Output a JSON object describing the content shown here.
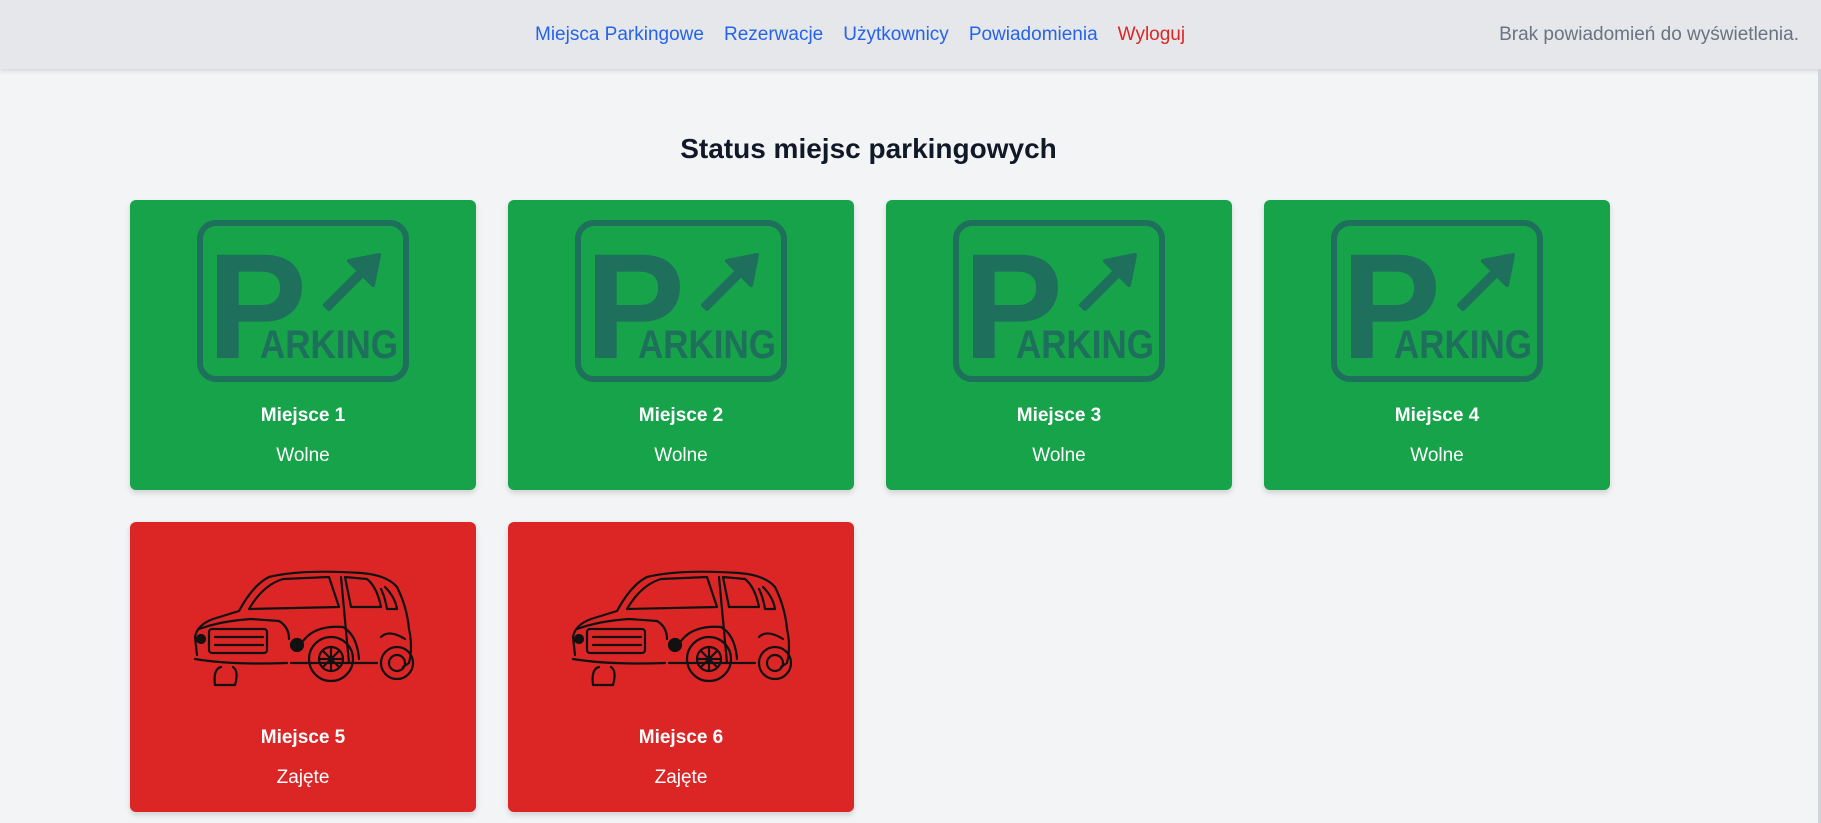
{
  "nav": {
    "links": [
      "Miejsca Parkingowe",
      "Rezerwacje",
      "Użytkownicy",
      "Powiadomienia"
    ],
    "logout": "Wyloguj",
    "notification_text": "Brak powiadomień do wyświetlenia."
  },
  "main": {
    "title": "Status miejsc parkingowych",
    "spots": [
      {
        "name": "Miejsce 1",
        "status": "Wolne",
        "icon": "parking-sign-icon"
      },
      {
        "name": "Miejsce 2",
        "status": "Wolne",
        "icon": "parking-sign-icon"
      },
      {
        "name": "Miejsce 3",
        "status": "Wolne",
        "icon": "parking-sign-icon"
      },
      {
        "name": "Miejsce 4",
        "status": "Wolne",
        "icon": "parking-sign-icon"
      },
      {
        "name": "Miejsce 5",
        "status": "Zajęte",
        "icon": "car-icon"
      },
      {
        "name": "Miejsce 6",
        "status": "Zajęte",
        "icon": "car-icon"
      }
    ]
  },
  "colors": {
    "free": "#16a34a",
    "taken": "#dc2626",
    "link": "#2563eb",
    "logout": "#dc2626"
  }
}
